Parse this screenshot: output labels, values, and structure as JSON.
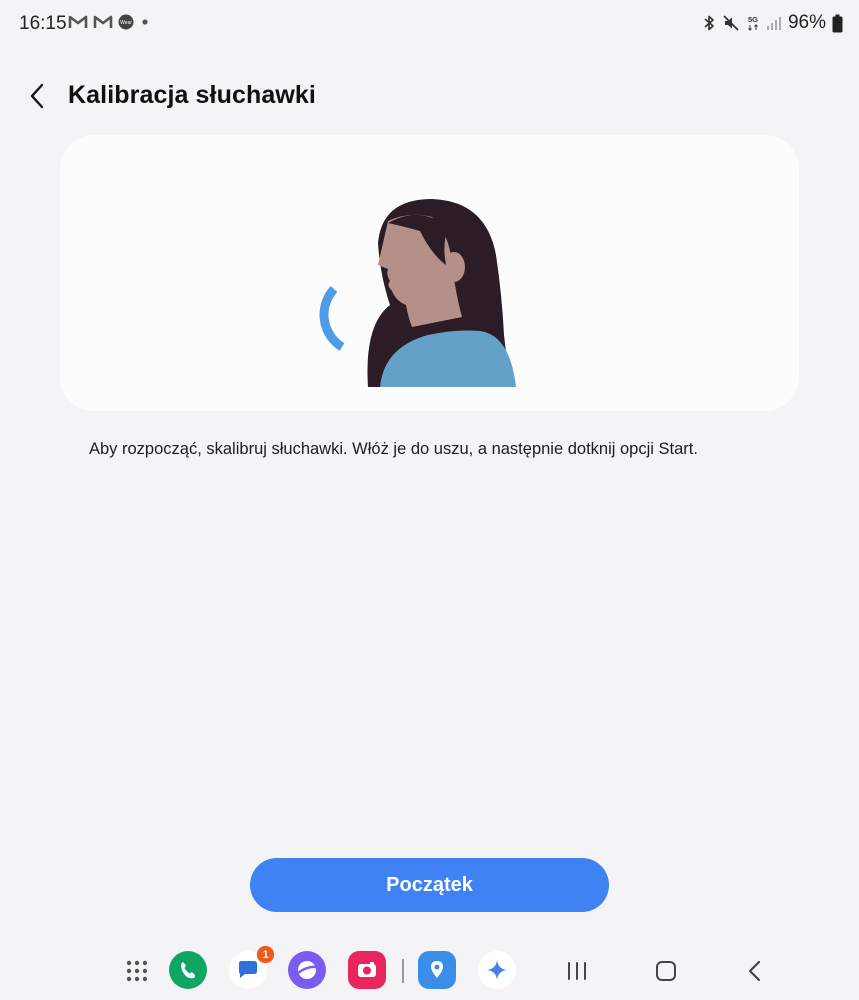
{
  "status_bar": {
    "time": "16:15",
    "left_icons": [
      "gmail-icon",
      "gmail-icon",
      "wear-icon",
      "dot-icon"
    ],
    "wear_label": "Wear",
    "network_label": "5G",
    "battery_percent": "96%"
  },
  "header": {
    "title": "Kalibracja słuchawki"
  },
  "description": {
    "text": "Aby rozpocząć, skalibruj słuchawki. Włóż je do uszu, a następnie dotknij opcji Start."
  },
  "start_button": {
    "label": "Początek",
    "color": "#3e82f3"
  },
  "dock": {
    "apps": [
      {
        "name": "app-drawer-icon"
      },
      {
        "name": "phone-app-icon",
        "color": "#0fa562"
      },
      {
        "name": "messages-app-icon",
        "badge": "1"
      },
      {
        "name": "internet-app-icon",
        "color": "#7b5cf0"
      },
      {
        "name": "camera-app-icon",
        "color": "#e8265d"
      },
      {
        "name": "maps-app-icon",
        "color": "#3a8de8"
      },
      {
        "name": "gemini-app-icon"
      }
    ],
    "nav": [
      "recents-icon",
      "home-icon",
      "back-nav-icon"
    ]
  }
}
